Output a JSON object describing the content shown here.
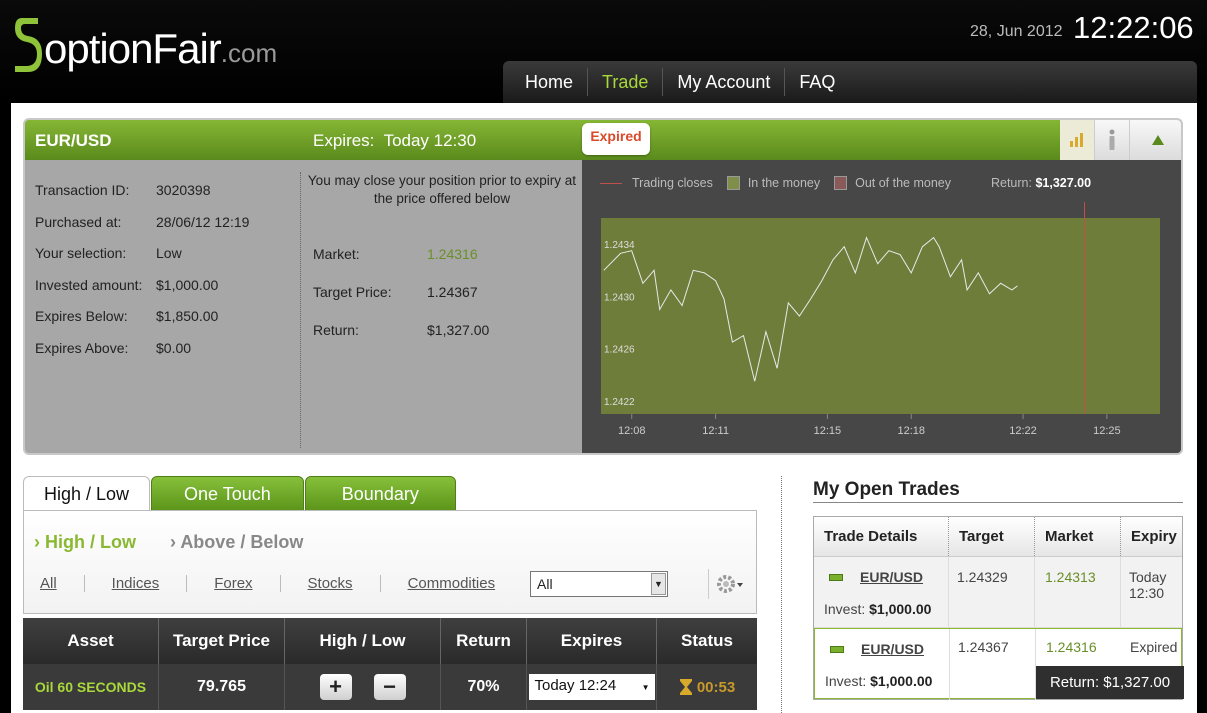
{
  "brand": {
    "name": "optionFair",
    "tld": ".com",
    "accent": "#a8d83a"
  },
  "datetime": {
    "date": "28, Jun 2012",
    "time": "12:22:06"
  },
  "nav": {
    "items": [
      "Home",
      "Trade",
      "My Account",
      "FAQ"
    ],
    "active": "Trade"
  },
  "position": {
    "asset": "EUR/USD",
    "expires_label": "Expires:",
    "expires_value": "Today 12:30",
    "status_badge": "Expired",
    "tools": [
      "chart-icon",
      "info-icon",
      "collapse-icon"
    ],
    "details": [
      {
        "label": "Transaction ID:",
        "value": "3020398"
      },
      {
        "label": "Purchased at:",
        "value": "28/06/12 12:19"
      },
      {
        "label": "Your selection:",
        "value": "Low"
      },
      {
        "label": "Invested amount:",
        "value": "$1,000.00"
      },
      {
        "label": "Expires Below:",
        "value": "$1,850.00"
      },
      {
        "label": "Expires Above:",
        "value": "$0.00"
      }
    ],
    "notice": "You may close your position prior to expiry at the price offered below",
    "market": {
      "label": "Market:",
      "value": "1.24316"
    },
    "target": {
      "label": "Target Price:",
      "value": "1.24367"
    },
    "return": {
      "label": "Return:",
      "value": "$1,327.00"
    }
  },
  "chart_data": {
    "type": "line",
    "legend": [
      "Trading closes",
      "In the money",
      "Out of the money"
    ],
    "legend_colors": {
      "trading_closes": "#c0504d",
      "in_the_money": "#7f8f4a",
      "out_of_the_money": "#8a5a5a"
    },
    "return_label": "Return:",
    "return_value": "$1,327.00",
    "x_ticks": [
      "12:08",
      "12:11",
      "12:15",
      "12:18",
      "12:22",
      "12:25"
    ],
    "y_ticks": [
      "1.2434",
      "1.2430",
      "1.2426",
      "1.2422"
    ],
    "ylim": [
      1.2421,
      1.2436
    ],
    "xlim_minutes": [
      6.9,
      26.9
    ],
    "closing_line_minute": 24.2,
    "series": [
      {
        "x": [
          7.0,
          7.6,
          8.0,
          8.4,
          8.8,
          9.0,
          9.4,
          9.8,
          10.2,
          10.6,
          11.0,
          11.3,
          11.6,
          12.0,
          12.4,
          12.8,
          13.2,
          13.6,
          14.0,
          14.4,
          14.8,
          15.2,
          15.6,
          16.0,
          16.4,
          16.8,
          17.2,
          17.6,
          18.0,
          18.4,
          18.8,
          19.0,
          19.4,
          19.8,
          20.0,
          20.4,
          20.8,
          21.2,
          21.6,
          21.8
        ],
        "y": [
          1.2432,
          1.24333,
          1.24335,
          1.2431,
          1.2432,
          1.2429,
          1.24305,
          1.24293,
          1.2432,
          1.24318,
          1.24312,
          1.24298,
          1.24265,
          1.2427,
          1.24235,
          1.24273,
          1.24245,
          1.24295,
          1.24285,
          1.24298,
          1.24312,
          1.24328,
          1.24338,
          1.24318,
          1.24345,
          1.24325,
          1.24335,
          1.24332,
          1.24318,
          1.24338,
          1.24345,
          1.24338,
          1.24315,
          1.24328,
          1.24305,
          1.24318,
          1.24302,
          1.2431,
          1.24305,
          1.24308
        ]
      }
    ],
    "colors": {
      "plot_bg": "#6f7d3a",
      "line": "#e8e8e8",
      "frame": "#474747",
      "closing": "#c0504d"
    }
  },
  "trade_tabs": {
    "items": [
      "High / Low",
      "One Touch",
      "Boundary"
    ],
    "active": "High / Low"
  },
  "sub_tabs": {
    "items": [
      "High / Low",
      "Above / Below"
    ],
    "active": "High / Low"
  },
  "filters": {
    "items": [
      "All",
      "Indices",
      "Forex",
      "Stocks",
      "Commodities"
    ],
    "select_value": "All"
  },
  "assets_table": {
    "headers": [
      "Asset",
      "Target Price",
      "High / Low",
      "Return",
      "Expires",
      "Status"
    ],
    "rows": [
      {
        "asset": "Oil 60 SECONDS",
        "target": "79.765",
        "return": "70%",
        "expires": "Today 12:24",
        "status": "00:53"
      }
    ]
  },
  "open_trades": {
    "title": "My Open Trades",
    "headers": [
      "Trade Details",
      "Target",
      "Market",
      "Expiry"
    ],
    "rows": [
      {
        "asset": "EUR/USD",
        "invest_label": "Invest:",
        "invest": "$1,000.00",
        "target": "1.24329",
        "market": "1.24313",
        "expiry": "Today 12:30"
      },
      {
        "asset": "EUR/USD",
        "invest_label": "Invest:",
        "invest": "$1,000.00",
        "target": "1.24367",
        "market": "1.24316",
        "expiry": "Expired",
        "return": "Return: $1,327.00"
      }
    ]
  }
}
